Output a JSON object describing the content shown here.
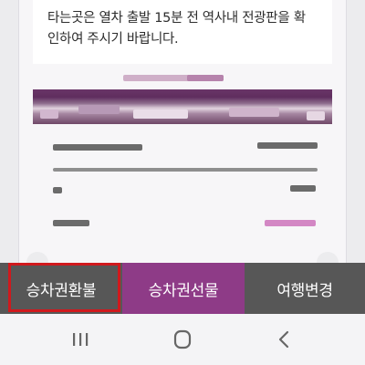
{
  "notice": {
    "text_line1": "타는곳은 열차 출발 15분 전 역사내 전광판을 확",
    "text_line2": "인하여 주시기 바랍니다."
  },
  "actions": {
    "refund_label": "승차권환불",
    "gift_label": "승차권선물",
    "change_label": "여행변경"
  },
  "colors": {
    "accent_purple": "#8e3b87",
    "action_gray": "#575757",
    "highlight_red": "#d0191d"
  },
  "nav": {
    "icons": [
      "recent-apps-icon",
      "home-icon",
      "back-icon"
    ]
  }
}
